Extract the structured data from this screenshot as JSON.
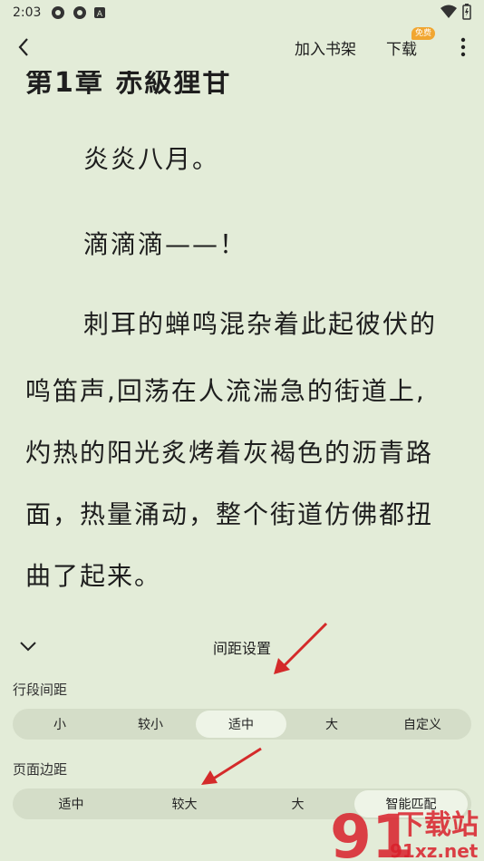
{
  "status": {
    "time": "2:03"
  },
  "topbar": {
    "add_to_shelf": "加入书架",
    "download": "下载",
    "download_badge": "免费"
  },
  "content": {
    "chapter_title": "第1章 赤級狸甘",
    "paragraphs": [
      "炎炎八月。",
      "滴滴滴——！",
      "刺耳的蝉鸣混杂着此起彼伏的",
      "鸣笛声,回荡在人流湍急的街道上,",
      "灼热的阳光炙烤着灰褐色的沥青路",
      "面，热量涌动，整个街道仿佛都扭",
      "曲了起来。"
    ]
  },
  "panel": {
    "title": "间距设置",
    "line_spacing_label": "行段间距",
    "line_spacing_options": [
      "小",
      "较小",
      "适中",
      "大",
      "自定义"
    ],
    "line_spacing_selected": "适中",
    "page_margin_label": "页面边距",
    "page_margin_options": [
      "适中",
      "较大",
      "大",
      "智能匹配"
    ],
    "page_margin_selected": "智能匹配"
  },
  "watermark": {
    "brand": "下载站",
    "site": "91xz.net"
  },
  "colors": {
    "background": "#e3ecd8",
    "segment_bg": "#d4ddc8",
    "segment_active": "#eef4e7",
    "arrow": "#d42a2a",
    "badge": "#f1a631"
  }
}
